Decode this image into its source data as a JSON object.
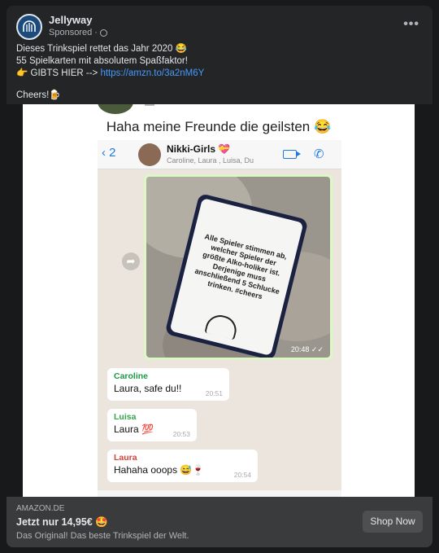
{
  "post": {
    "page_name": "Jellyway",
    "sponsored_label": "Sponsored",
    "separator": "·",
    "globe_icon": "globe-icon",
    "more_icon": "•••",
    "line1": "Dieses Trinkspiel rettet das Jahr 2020 😂",
    "line2": "55 Spielkarten mit absolutem Spaßfaktor!",
    "line3_prefix": "👉 GIBTS HIER --> ",
    "link": "https://amzn.to/3a2nM6Y",
    "line4": "Cheers!🍺"
  },
  "screenshot": {
    "caption": "Haha meine Freunde die geilsten 😂",
    "chat": {
      "back_label": "‹ 2",
      "group_name": "Nikki-Girls 💝",
      "members": "Caroline, Laura , Luisa, Du",
      "video_icon": "video-camera-icon",
      "call_icon": "✆",
      "image_card_text": "Alle Spieler stimmen ab, welcher Spieler der größte Alko-holiker ist. Derjenige muss anschließend 5 Schlucke trinken. #cheers",
      "image_time": "20:48 ✓✓",
      "forward_icon": "➦",
      "messages": [
        {
          "sender": "Caroline",
          "color": "#1b9a45",
          "text": "Laura, safe du!!",
          "time": "20:51"
        },
        {
          "sender": "Luisa",
          "color": "#33a64a",
          "text": "Laura 💯",
          "time": "20:53"
        },
        {
          "sender": "Laura",
          "color": "#d0443a",
          "text": "Hahaha ooops 😅🍷",
          "time": "20:54"
        }
      ]
    }
  },
  "ad": {
    "domain": "AMAZON.DE",
    "headline": "Jetzt nur 14,95€ 🤩",
    "description": "Das Original! Das beste Trinkspiel der Welt.",
    "cta": "Shop Now"
  }
}
